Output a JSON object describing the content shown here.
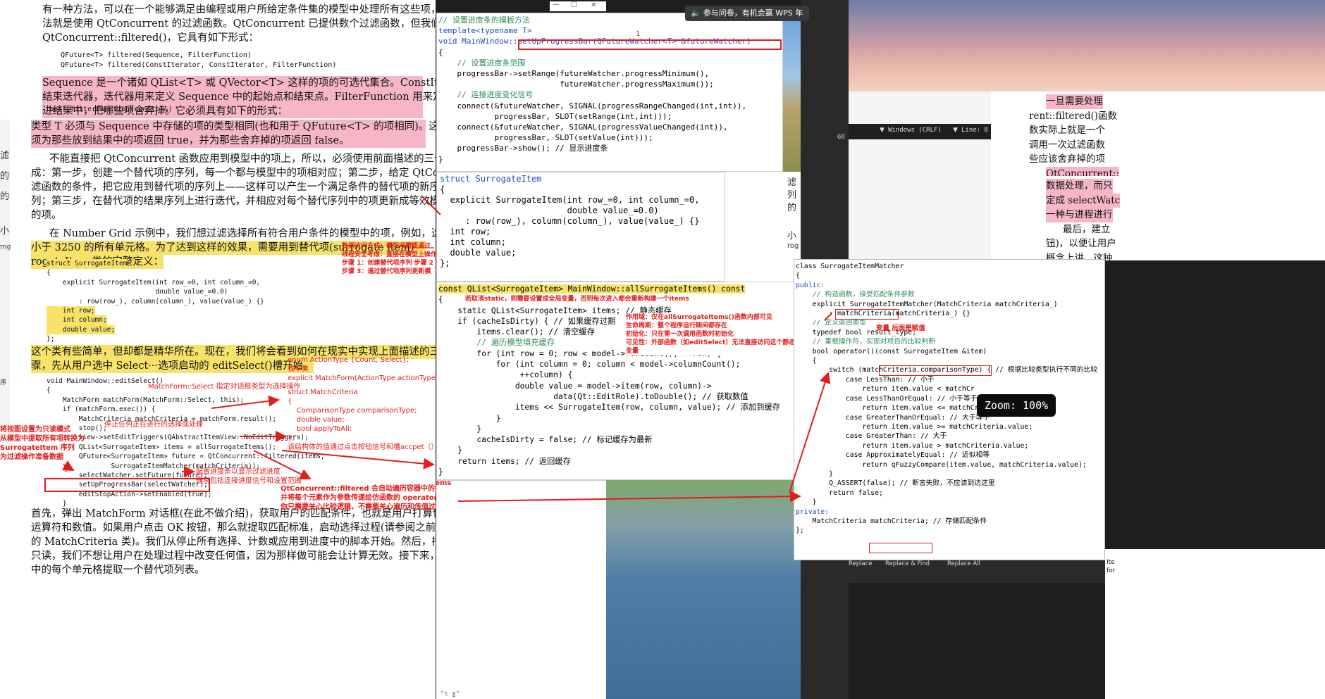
{
  "colors": {
    "background": "#1e1e1e",
    "doc_bg": "#ffffff",
    "highlight_pink": "#f7b6c7",
    "highlight_yellow": "#f7e36a",
    "annotation_red": "#e21b1b",
    "code_comment": "#2e8b57",
    "code_keyword": "#1f4fbf",
    "code_function": "#7a3fbf"
  },
  "notification": {
    "icon": "speaker-icon",
    "text": "参与问卷，有机会赢 WPS 年卡!"
  },
  "window_controls": [
    "minimize-icon",
    "maximize-icon",
    "close-icon"
  ],
  "zoom": {
    "label": "Zoom: 100%"
  },
  "left_doc": {
    "top_lines": [
      "有一种方法，可以在一个能够满足由编程或用户所给定条件集的模型中处理所有这些项，这",
      "法就是使用 QtConcurrent 的过滤函数。QtConcurrent 已提供数个过滤函数，但我们将要用到的是",
      "QtConcurrent::filtered()，它具有如下形式："
    ],
    "signatures": [
      "QFuture<T> filtered(Sequence, FilterFunction)",
      "QFuture<T> filtered(ConstIterator, ConstIterator, FilterFunction)"
    ],
    "pink_paragraph": [
      "Sequence 是一个诸如 QList<T> 或 QVector<T> 这样的项的可选代集合。ConstIterator 是开始和",
      "结束迭代器，迭代器用来定义 Sequence 中的起始点和结束点。FilterFunction 用来定义把哪些项放",
      "进结果中，把哪些项舍弃掉。它必须具有如下的形式："
    ],
    "filter_sig": "bool filterFunction(const T&)",
    "para_type": [
      "类型 T 必须与 Sequence 中存储的项的类型相同(也和用于 QFuture<T> 的项相同)。这个函数必",
      "须为那些放到结果中的项返回 true，并为那些舍弃掉的项返回 false。"
    ],
    "para_three": [
      "不能直接把 QtConcurrent 函数应用到模型中的项上，所以，必须使用前面描述的三个步骤来完",
      "成：第一步，创建一个替代项的序列，每一个都与模型中的项相对应；第二步，给定 QtConcurrent 过",
      "滤函数的条件，把它应用到替代项的序列上——这样可以产生一个满足条件的替代项的新序",
      "列；第三步，在替代项的结果序列上进行迭代，并相应对每个替代序列中的项更新成等效模型中",
      "的项。"
    ],
    "para_number_grid": [
      "在 Number Grid 示例中，我们想过滤选择所有符合用户条件的模型中的项，例如，选择包含值",
      "小于 3250 的所有单元格。为了达到这样的效果，需要用到替代项(surrogate item)——以下是 Sur-",
      "rogateItem 类的完整定义："
    ],
    "struct_code": [
      "struct SurrogateItem",
      "{",
      "    explicit SurrogateItem(int row_=0, int column_=0,",
      "                           double value_=0.0)",
      "        : row(row_), column(column_), value(value_) {}",
      "",
      "    int row;",
      "    int column;",
      "    double value;",
      "};"
    ],
    "para_simple": [
      "这个类有些简单，但却都是精华所在。现在，我们将会看到如何在现实中实现上面描述的三个步",
      "骤，先从用户选中 Select···选项启动的 editSelect()槽开始。"
    ],
    "edit_code": [
      "void MainWindow::editSelect()",
      "{",
      "    MatchForm matchForm(MatchForm::Select, this);",
      "    if (matchForm.exec()) {",
      "        MatchCriteria matchCriteria = matchForm.result();",
      "        stop();",
      "        view->setEditTriggers(QAbstractItemView::NoEditTriggers);",
      "        QList<SurrogateItem> items = allSurrogateItems();",
      "        QFuture<SurrogateItem> future = QtConcurrent::filtered(items,",
      "                SurrogateItemMatcher(matchCriteria));",
      "        selectWatcher.setFuture(future);",
      "        setUpProgressBar(selectWatcher);",
      "        editStopAction->setEnabled(true);",
      "    }",
      "}"
    ],
    "para_bottom": [
      "首先，弹出 MatchForm 对话框(在此不做介绍)，获取用户的匹配条件，也就是用户打算使用的比较",
      "运算符和数值。如果用户点击 OK 按钮，那么就提取匹配标准，启动选择过程(请参阅之前介绍过",
      "的 MatchCriteria 类)。我们从停止所有选择、计数或应用到进度中的脚本开始。然后，把视图变为",
      "只读，我们不想让用户在处理过程中改变任何值，因为那样做可能会让计算无效。接下来，为网格",
      "中的每个单元格提取一个替代项列表。"
    ],
    "marker_one": "1"
  },
  "annotations": {
    "data_access": [
      "数据访问方式：模型项需要通过",
      "线程安全考虑：直接在模型上操作",
      "步骤 1：创建替代项序列 步骤 2",
      "步骤 3：通过替代项序列更新模"
    ],
    "matchform_select": "MatchForm::Select 指定对话框类型为选择操作",
    "stop_note": "停止任何正在进行的选择或处理",
    "enum_note": [
      "enum ActionType {Count, Select};",
      "枚举类",
      "explicit MatchForm(ActionType actionType,"
    ],
    "struct_criteria": [
      "struct MatchCriteria",
      "{",
      "    ComparisonType comparisonType;",
      "    double value;",
      "    bool applyToAll;",
      "};"
    ],
    "struct_note": "该结构体的值通过点击按钮信号和槽accpet（）填",
    "readonly_note": [
      "将视图设置为只读模式",
      "从模型中提取所有项转换为",
      "SurrogateItem 序列",
      "为过滤操作准备数据"
    ],
    "progress_note": [
      "配置进度条以显示过滤进度",
      "通常包括连接进度信号和设置范围"
    ],
    "filtered_note": [
      "QtConcurrent::filtered 会自动遍历容器中的每个元素，",
      "并将每个元素作为参数传递给仿函数的 operator() 方法。",
      "你只需要关心比较逻辑，不需要关心遍历和传值过程。"
    ],
    "iter_note": "这里是遍历items",
    "static_note": [
      "若取消static，则需要设置成全局变量，否则每次进入都会重新构建一个items"
    ],
    "static_detail": [
      "作用域：仅在allSurrogateItems()函数内部可见",
      "生命周期：整个程序运行期间都存在",
      "初始化：只在第一次调用函数时初始化",
      "可见性：外部函数（如editSelect）无法直接访问这个静态",
      "变量"
    ],
    "var_note": "变量 后面是赋值",
    "marker_one": "1"
  },
  "code_progress": {
    "lines": [
      "// 设置进度条的模板方法",
      "template<typename T>",
      "void MainWindow::setUpProgressBar(QFutureWatcher<T> &futureWatcher)",
      "{",
      "    // 设置进度条范围",
      "    progressBar->setRange(futureWatcher.progressMinimum(),",
      "                          futureWatcher.progressMaximum());",
      "    // 连接进度变化信号",
      "    connect(&futureWatcher, SIGNAL(progressRangeChanged(int,int)),",
      "            progressBar, SLOT(setRange(int,int)));",
      "    connect(&futureWatcher, SIGNAL(progressValueChanged(int)),",
      "            progressBar, SLOT(setValue(int)));",
      "    progressBar->show(); // 显示进度条",
      "}"
    ]
  },
  "code_struct": {
    "lines": [
      "struct SurrogateItem",
      "{",
      "  explicit SurrogateItem(int row_=0, int column_=0,",
      "                         double value_=0.0)",
      "     : row(row_), column(column_), value(value_) {}",
      "",
      "  int row;",
      "  int column;",
      "  double value;",
      "};"
    ]
  },
  "code_all_items": {
    "lines": [
      "const QList<SurrogateItem> MainWindow::allSurrogateItems() const",
      "{",
      "    static QList<SurrogateItem> items; // 静态缓存",
      "    if (cacheIsDirty) { // 如果缓存过期",
      "        items.clear(); // 清空缓存",
      "        // 遍历模型填充缓存",
      "        for (int row = 0; row < model->rowCount(); ++row) {",
      "            for (int column = 0; column < model->columnCount();",
      "                 ++column) {",
      "                double value = model->item(row, column)->",
      "                        data(Qt::EditRole).toDouble(); // 获取数值",
      "                items << SurrogateItem(row, column, value); // 添加到缓存",
      "            }",
      "        }",
      "        cacheIsDirty = false; // 标记缓存为最新",
      "    }",
      "    return items; // 返回缓存",
      "}"
    ]
  },
  "code_matcher": {
    "lines": [
      "class SurrogateItemMatcher",
      "{",
      "public:",
      "    // 构造函数，接受匹配条件参数",
      "    explicit SurrogateItemMatcher(MatchCriteria matchCriteria_)",
      "        : matchCriteria(matchCriteria_) {}",
      "",
      "    // 定义返回类型",
      "    typedef bool result_type;",
      "",
      "    // 重载操作符，实现对项目的比较判断",
      "    bool operator()(const SurrogateItem &item)",
      "    {",
      "        switch (matchCriteria.comparisonType) { // 根据比较类型执行不同的比较",
      "            case LessThan: // 小于",
      "                return item.value < matchCr",
      "            case LessThanOrEqual: // 小于等于",
      "                return item.value <= matchCriteria.value;",
      "            case GreaterThanOrEqual: // 大于等于",
      "                return item.value >= matchCriteria.value;",
      "            case GreaterThan: // 大于",
      "                return item.value > matchCriteria.value;",
      "            case ApproximatelyEqual: // 近似相等",
      "                return qFuzzyCompare(item.value, matchCriteria.value);",
      "        }",
      "        Q_ASSERT(false); // 断言失败，不应该到达这里",
      "        return false;",
      "    }",
      "",
      "private:",
      "    MatchCriteria matchCriteria; // 存储匹配条件"
    ],
    "closing": "};"
  },
  "right_doc": {
    "lines": [
      "一旦需要处理",
      "rent::filtered()函数",
      "数实际上就是一个",
      "调用一次过滤函数",
      "些应该舍弃掉的项",
      "QtConcurrent::",
      "数据处理，而只",
      "定成 selectWatc",
      "一种与进程进行",
      "最后，建立",
      "钮)，以便让用户",
      "概念上讲，这种"
    ]
  },
  "editor_statusbar": {
    "encoding": "Windows (CRLF)",
    "line_label": "Line: 8",
    "number_label": "68"
  },
  "find_bar": {
    "replace": "Replace",
    "replace_find": "Replace & Find",
    "replace_all": "Replace All"
  },
  "small_texts": {
    "middle_side": [
      "滤",
      "列",
      "的",
      "小",
      "rog"
    ],
    "left_side": [
      "滤",
      "的",
      "的",
      "小",
      "rog",
      "序"
    ],
    "bottom_cut": "\"ɩ ɣ\"",
    "right_bottom": [
      "Ite",
      "for"
    ]
  }
}
